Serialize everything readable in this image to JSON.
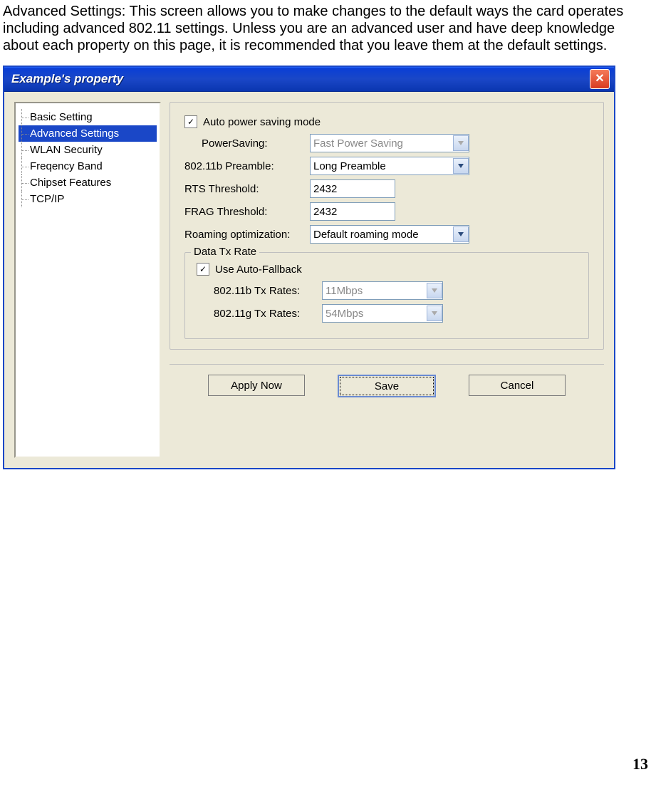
{
  "intro": "Advanced Settings: This screen allows you to make changes to the default ways the card operates including advanced 802.11 settings. Unless you are an advanced user and have deep knowledge about each property on this page, it is recommended that you leave them at the default settings.",
  "window": {
    "title": "Example's property"
  },
  "tree": {
    "items": [
      {
        "label": "Basic Setting"
      },
      {
        "label": "Advanced Settings"
      },
      {
        "label": "WLAN Security"
      },
      {
        "label": "Freqency Band"
      },
      {
        "label": "Chipset Features"
      },
      {
        "label": "TCP/IP"
      }
    ],
    "selected_index": 1
  },
  "form": {
    "auto_power_saving": {
      "label": "Auto power saving mode",
      "checked": true
    },
    "power_saving": {
      "label": "PowerSaving:",
      "value": "Fast Power Saving",
      "disabled": true
    },
    "preamble": {
      "label": "802.11b Preamble:",
      "value": "Long Preamble"
    },
    "rts": {
      "label": "RTS Threshold:",
      "value": "2432"
    },
    "frag": {
      "label": "FRAG Threshold:",
      "value": "2432"
    },
    "roaming": {
      "label": "Roaming optimization:",
      "value": "Default roaming mode"
    },
    "datarate": {
      "legend": "Data Tx Rate",
      "autofallback": {
        "label": "Use Auto-Fallback",
        "checked": true
      },
      "b_rate": {
        "label": "802.11b Tx Rates:",
        "value": "11Mbps",
        "disabled": true
      },
      "g_rate": {
        "label": "802.11g Tx Rates:",
        "value": "54Mbps",
        "disabled": true
      }
    }
  },
  "buttons": {
    "apply": "Apply Now",
    "save": "Save",
    "cancel": "Cancel"
  },
  "page_number": "13"
}
